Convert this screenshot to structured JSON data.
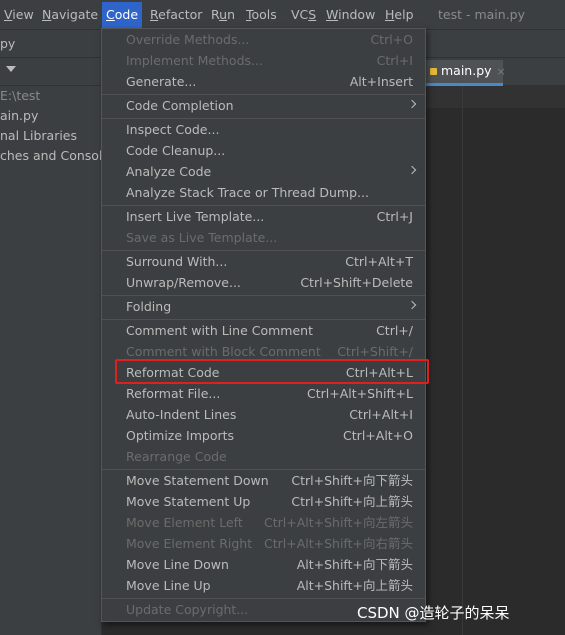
{
  "menubar": {
    "items": [
      {
        "pre": "",
        "u": "V",
        "post": "iew"
      },
      {
        "pre": "",
        "u": "N",
        "post": "avigate"
      },
      {
        "pre": "",
        "u": "C",
        "post": "ode"
      },
      {
        "pre": "",
        "u": "R",
        "post": "efactor"
      },
      {
        "pre": "R",
        "u": "u",
        "post": "n"
      },
      {
        "pre": "",
        "u": "T",
        "post": "ools"
      },
      {
        "pre": "VC",
        "u": "S",
        "post": ""
      },
      {
        "pre": "",
        "u": "W",
        "post": "indow"
      },
      {
        "pre": "",
        "u": "H",
        "post": "elp"
      }
    ],
    "title": "test - main.py"
  },
  "navbar": {
    "crumb": "py"
  },
  "project": {
    "rows": [
      "E:\\test",
      "ain.py",
      "nal Libraries",
      "ches and Consoles"
    ]
  },
  "editor": {
    "tab_label": "main.py",
    "tab_close": "×"
  },
  "code_menu": {
    "items": [
      {
        "label": "Override Methods...",
        "shortcut": "Ctrl+O",
        "disabled": true
      },
      {
        "label": "Implement Methods...",
        "shortcut": "Ctrl+I",
        "disabled": true
      },
      {
        "label": "Generate...",
        "shortcut": "Alt+Insert",
        "disabled": false
      },
      {
        "label": "Code Completion",
        "shortcut": "",
        "disabled": false,
        "submenu": true
      },
      {
        "label": "Inspect Code...",
        "shortcut": "",
        "disabled": false
      },
      {
        "label": "Code Cleanup...",
        "shortcut": "",
        "disabled": false
      },
      {
        "label": "Analyze Code",
        "shortcut": "",
        "disabled": false,
        "submenu": true
      },
      {
        "label": "Analyze Stack Trace or Thread Dump...",
        "shortcut": "",
        "disabled": false
      },
      {
        "label": "Insert Live Template...",
        "shortcut": "Ctrl+J",
        "disabled": false
      },
      {
        "label": "Save as Live Template...",
        "shortcut": "",
        "disabled": true
      },
      {
        "label": "Surround With...",
        "shortcut": "Ctrl+Alt+T",
        "disabled": false
      },
      {
        "label": "Unwrap/Remove...",
        "shortcut": "Ctrl+Shift+Delete",
        "disabled": false
      },
      {
        "label": "Folding",
        "shortcut": "",
        "disabled": false,
        "submenu": true
      },
      {
        "label": "Comment with Line Comment",
        "shortcut": "Ctrl+/",
        "disabled": false
      },
      {
        "label": "Comment with Block Comment",
        "shortcut": "Ctrl+Shift+/",
        "disabled": true
      },
      {
        "label": "Reformat Code",
        "shortcut": "Ctrl+Alt+L",
        "disabled": false
      },
      {
        "label": "Reformat File...",
        "shortcut": "Ctrl+Alt+Shift+L",
        "disabled": false
      },
      {
        "label": "Auto-Indent Lines",
        "shortcut": "Ctrl+Alt+I",
        "disabled": false
      },
      {
        "label": "Optimize Imports",
        "shortcut": "Ctrl+Alt+O",
        "disabled": false
      },
      {
        "label": "Rearrange Code",
        "shortcut": "",
        "disabled": true
      },
      {
        "label": "Move Statement Down",
        "shortcut": "Ctrl+Shift+向下箭头",
        "disabled": false
      },
      {
        "label": "Move Statement Up",
        "shortcut": "Ctrl+Shift+向上箭头",
        "disabled": false
      },
      {
        "label": "Move Element Left",
        "shortcut": "Ctrl+Alt+Shift+向左箭头",
        "disabled": true
      },
      {
        "label": "Move Element Right",
        "shortcut": "Ctrl+Alt+Shift+向右箭头",
        "disabled": true
      },
      {
        "label": "Move Line Down",
        "shortcut": "Alt+Shift+向下箭头",
        "disabled": false
      },
      {
        "label": "Move Line Up",
        "shortcut": "Alt+Shift+向上箭头",
        "disabled": false
      },
      {
        "label": "Update Copyright...",
        "shortcut": "",
        "disabled": true
      }
    ]
  },
  "watermark": "CSDN @造轮子的呆呆",
  "colors": {
    "active_menu_bg": "#2f65ca",
    "highlight_box": "#e0201e",
    "menu_bg": "#3c3f41",
    "editor_bg": "#2b2b2b"
  }
}
